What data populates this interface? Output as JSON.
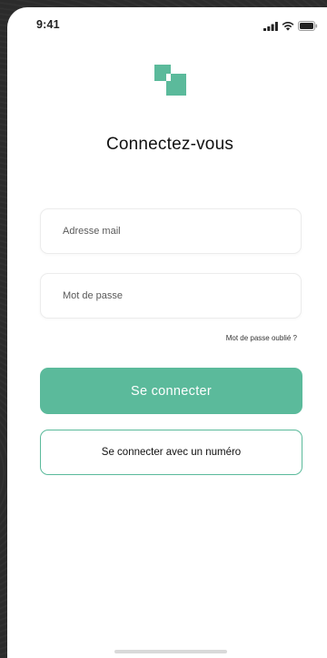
{
  "status_bar": {
    "time": "9:41",
    "icons": [
      "signal-icon",
      "wifi-icon",
      "battery-icon"
    ]
  },
  "brand": {
    "logo_icon": "stacked-squares-logo",
    "accent_color": "#5bba9b"
  },
  "login": {
    "title": "Connectez-vous",
    "email_placeholder": "Adresse mail",
    "email_value": "",
    "password_placeholder": "Mot de passe",
    "password_value": "",
    "forgot_password": "Mot de passe oublié ?",
    "submit_label": "Se connecter",
    "phone_login_label": "Se connecter avec un numéro"
  }
}
